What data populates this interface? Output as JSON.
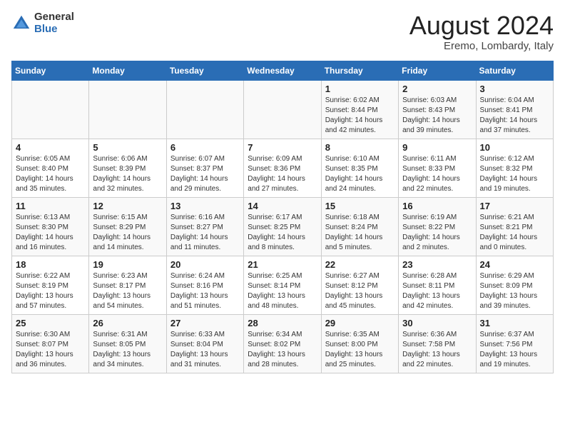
{
  "header": {
    "logo_general": "General",
    "logo_blue": "Blue",
    "title": "August 2024",
    "subtitle": "Eremo, Lombardy, Italy"
  },
  "weekdays": [
    "Sunday",
    "Monday",
    "Tuesday",
    "Wednesday",
    "Thursday",
    "Friday",
    "Saturday"
  ],
  "weeks": [
    [
      {
        "day": "",
        "info": ""
      },
      {
        "day": "",
        "info": ""
      },
      {
        "day": "",
        "info": ""
      },
      {
        "day": "",
        "info": ""
      },
      {
        "day": "1",
        "info": "Sunrise: 6:02 AM\nSunset: 8:44 PM\nDaylight: 14 hours\nand 42 minutes."
      },
      {
        "day": "2",
        "info": "Sunrise: 6:03 AM\nSunset: 8:43 PM\nDaylight: 14 hours\nand 39 minutes."
      },
      {
        "day": "3",
        "info": "Sunrise: 6:04 AM\nSunset: 8:41 PM\nDaylight: 14 hours\nand 37 minutes."
      }
    ],
    [
      {
        "day": "4",
        "info": "Sunrise: 6:05 AM\nSunset: 8:40 PM\nDaylight: 14 hours\nand 35 minutes."
      },
      {
        "day": "5",
        "info": "Sunrise: 6:06 AM\nSunset: 8:39 PM\nDaylight: 14 hours\nand 32 minutes."
      },
      {
        "day": "6",
        "info": "Sunrise: 6:07 AM\nSunset: 8:37 PM\nDaylight: 14 hours\nand 29 minutes."
      },
      {
        "day": "7",
        "info": "Sunrise: 6:09 AM\nSunset: 8:36 PM\nDaylight: 14 hours\nand 27 minutes."
      },
      {
        "day": "8",
        "info": "Sunrise: 6:10 AM\nSunset: 8:35 PM\nDaylight: 14 hours\nand 24 minutes."
      },
      {
        "day": "9",
        "info": "Sunrise: 6:11 AM\nSunset: 8:33 PM\nDaylight: 14 hours\nand 22 minutes."
      },
      {
        "day": "10",
        "info": "Sunrise: 6:12 AM\nSunset: 8:32 PM\nDaylight: 14 hours\nand 19 minutes."
      }
    ],
    [
      {
        "day": "11",
        "info": "Sunrise: 6:13 AM\nSunset: 8:30 PM\nDaylight: 14 hours\nand 16 minutes."
      },
      {
        "day": "12",
        "info": "Sunrise: 6:15 AM\nSunset: 8:29 PM\nDaylight: 14 hours\nand 14 minutes."
      },
      {
        "day": "13",
        "info": "Sunrise: 6:16 AM\nSunset: 8:27 PM\nDaylight: 14 hours\nand 11 minutes."
      },
      {
        "day": "14",
        "info": "Sunrise: 6:17 AM\nSunset: 8:25 PM\nDaylight: 14 hours\nand 8 minutes."
      },
      {
        "day": "15",
        "info": "Sunrise: 6:18 AM\nSunset: 8:24 PM\nDaylight: 14 hours\nand 5 minutes."
      },
      {
        "day": "16",
        "info": "Sunrise: 6:19 AM\nSunset: 8:22 PM\nDaylight: 14 hours\nand 2 minutes."
      },
      {
        "day": "17",
        "info": "Sunrise: 6:21 AM\nSunset: 8:21 PM\nDaylight: 14 hours\nand 0 minutes."
      }
    ],
    [
      {
        "day": "18",
        "info": "Sunrise: 6:22 AM\nSunset: 8:19 PM\nDaylight: 13 hours\nand 57 minutes."
      },
      {
        "day": "19",
        "info": "Sunrise: 6:23 AM\nSunset: 8:17 PM\nDaylight: 13 hours\nand 54 minutes."
      },
      {
        "day": "20",
        "info": "Sunrise: 6:24 AM\nSunset: 8:16 PM\nDaylight: 13 hours\nand 51 minutes."
      },
      {
        "day": "21",
        "info": "Sunrise: 6:25 AM\nSunset: 8:14 PM\nDaylight: 13 hours\nand 48 minutes."
      },
      {
        "day": "22",
        "info": "Sunrise: 6:27 AM\nSunset: 8:12 PM\nDaylight: 13 hours\nand 45 minutes."
      },
      {
        "day": "23",
        "info": "Sunrise: 6:28 AM\nSunset: 8:11 PM\nDaylight: 13 hours\nand 42 minutes."
      },
      {
        "day": "24",
        "info": "Sunrise: 6:29 AM\nSunset: 8:09 PM\nDaylight: 13 hours\nand 39 minutes."
      }
    ],
    [
      {
        "day": "25",
        "info": "Sunrise: 6:30 AM\nSunset: 8:07 PM\nDaylight: 13 hours\nand 36 minutes."
      },
      {
        "day": "26",
        "info": "Sunrise: 6:31 AM\nSunset: 8:05 PM\nDaylight: 13 hours\nand 34 minutes."
      },
      {
        "day": "27",
        "info": "Sunrise: 6:33 AM\nSunset: 8:04 PM\nDaylight: 13 hours\nand 31 minutes."
      },
      {
        "day": "28",
        "info": "Sunrise: 6:34 AM\nSunset: 8:02 PM\nDaylight: 13 hours\nand 28 minutes."
      },
      {
        "day": "29",
        "info": "Sunrise: 6:35 AM\nSunset: 8:00 PM\nDaylight: 13 hours\nand 25 minutes."
      },
      {
        "day": "30",
        "info": "Sunrise: 6:36 AM\nSunset: 7:58 PM\nDaylight: 13 hours\nand 22 minutes."
      },
      {
        "day": "31",
        "info": "Sunrise: 6:37 AM\nSunset: 7:56 PM\nDaylight: 13 hours\nand 19 minutes."
      }
    ]
  ]
}
